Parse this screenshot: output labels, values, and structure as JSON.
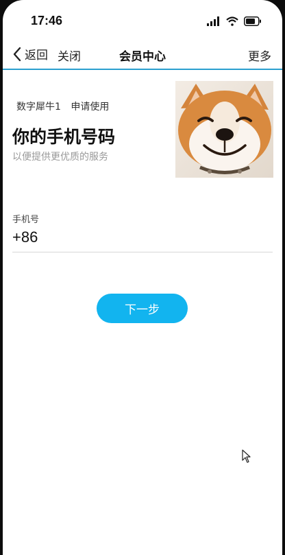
{
  "status_bar": {
    "time": "17:46"
  },
  "nav": {
    "back_label": "返回",
    "close_label": "关闭",
    "title": "会员中心",
    "more_label": "更多"
  },
  "app": {
    "name": "数字犀牛1",
    "request_text": "申请使用"
  },
  "headline": "你的手机号码",
  "subheadline": "以便提供更优质的服务",
  "form": {
    "phone_label": "手机号",
    "country_code": "+86",
    "phone_value": ""
  },
  "next_button": {
    "label": "下一步"
  },
  "colors": {
    "accent": "#12b4ef",
    "nav_divider": "#2a9fcf"
  }
}
